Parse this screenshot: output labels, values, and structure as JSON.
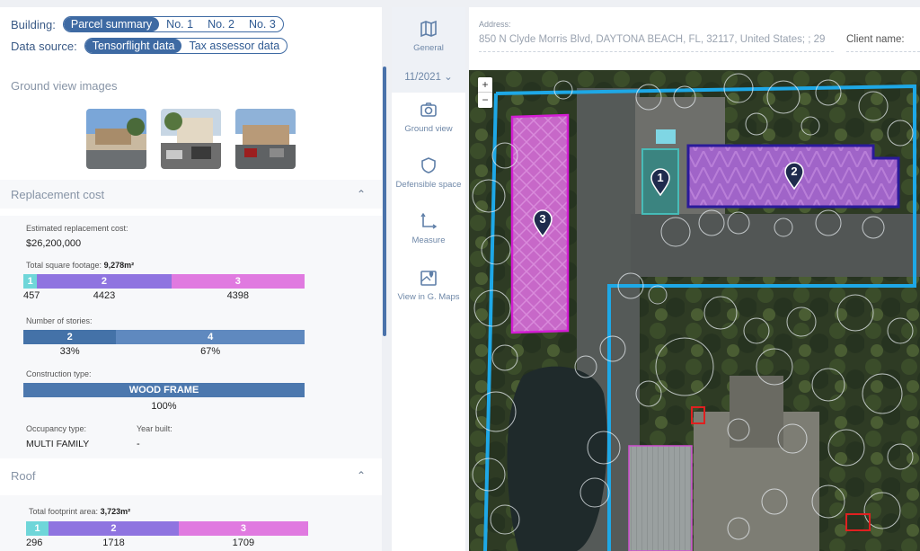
{
  "filters": {
    "building_label": "Building:",
    "building_tabs": [
      "Parcel summary",
      "No. 1",
      "No. 2",
      "No. 3"
    ],
    "building_active": 0,
    "source_label": "Data source:",
    "source_tabs": [
      "Tensorflight data",
      "Tax assessor data"
    ],
    "source_active": 0
  },
  "ground_view": {
    "title": "Ground view images"
  },
  "replacement": {
    "title": "Replacement cost",
    "est_label": "Estimated replacement cost:",
    "est_value": "$26,200,000",
    "sqft_label": "Total square footage:",
    "sqft_value": "9,278m²",
    "sqft_bar": [
      {
        "label": "1",
        "value": "457",
        "color": "#6fd6d9",
        "frac": 0.049
      },
      {
        "label": "2",
        "value": "4423",
        "color": "#8f74e0",
        "frac": 0.477
      },
      {
        "label": "3",
        "value": "4398",
        "color": "#e07ae0",
        "frac": 0.474
      }
    ],
    "stories_label": "Number of stories:",
    "stories_bar": [
      {
        "label": "2",
        "value": "33%",
        "color": "#4472a8",
        "frac": 0.33
      },
      {
        "label": "4",
        "value": "67%",
        "color": "#5f89bf",
        "frac": 0.67
      }
    ],
    "construction_label": "Construction type:",
    "construction_bar": {
      "label": "WOOD FRAME",
      "value": "100%",
      "color": "#4c78ae"
    },
    "occupancy_label": "Occupancy type:",
    "occupancy_value": "MULTI FAMILY",
    "year_label": "Year built:",
    "year_value": "-"
  },
  "roof": {
    "title": "Roof",
    "footprint_label": "Total footprint area:",
    "footprint_value": "3,723m²",
    "footprint_bar": [
      {
        "label": "1",
        "value": "296",
        "color": "#6fd6d9",
        "frac": 0.08
      },
      {
        "label": "2",
        "value": "1718",
        "color": "#8f74e0",
        "frac": 0.461
      },
      {
        "label": "3",
        "value": "1709",
        "color": "#e07ae0",
        "frac": 0.459
      }
    ]
  },
  "toolbar": {
    "general": "General",
    "date": "11/2021",
    "ground_view": "Ground view",
    "defensible": "Defensible space",
    "measure": "Measure",
    "gmaps": "View in G. Maps"
  },
  "address": {
    "label": "Address:",
    "value": "850 N Clyde Morris Blvd, DAYTONA BEACH, FL, 32117, United States; ; 29",
    "client_label": "Client name:"
  },
  "map": {
    "zoom_in": "+",
    "zoom_out": "−",
    "markers": [
      "1",
      "2",
      "3"
    ],
    "colors": {
      "parcel": "#1ea8e6",
      "b1": "#3fd0cc",
      "b2": "#2a1a9a",
      "b3": "#d41ed4"
    }
  }
}
